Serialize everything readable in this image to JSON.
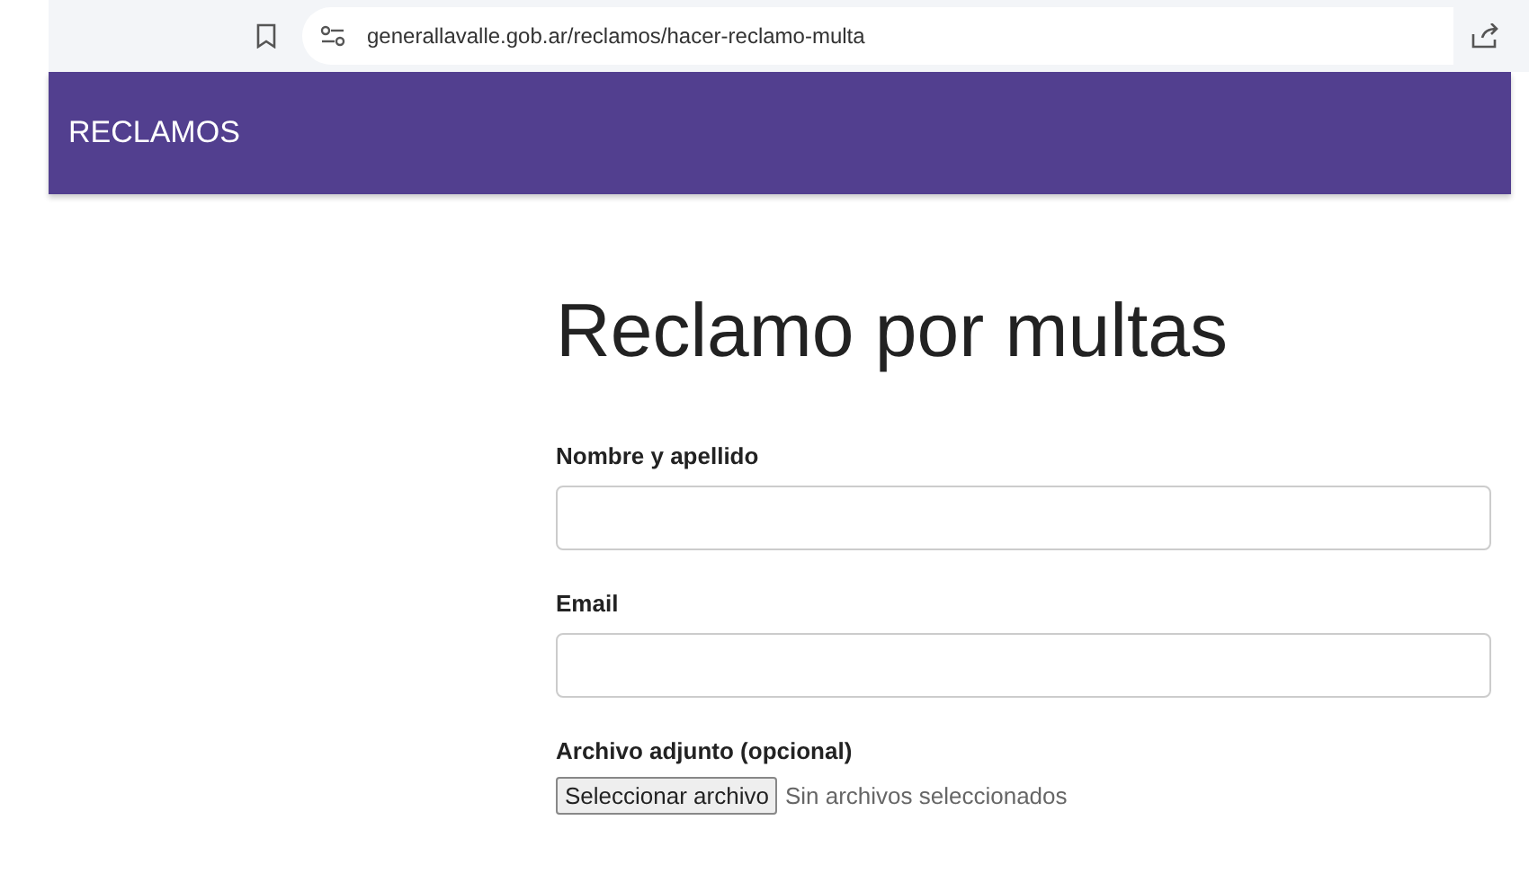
{
  "browser": {
    "url": "generallavalle.gob.ar/reclamos/hacer-reclamo-multa"
  },
  "header": {
    "title": "RECLAMOS"
  },
  "page": {
    "heading": "Reclamo por multas"
  },
  "fields": [
    {
      "kind": "text",
      "label": "Nombre y apellido"
    },
    {
      "kind": "text",
      "label": "Email"
    },
    {
      "kind": "file",
      "label": "Archivo adjunto (opcional)",
      "button": "Seleccionar archivo",
      "status": "Sin archivos seleccionados"
    }
  ]
}
